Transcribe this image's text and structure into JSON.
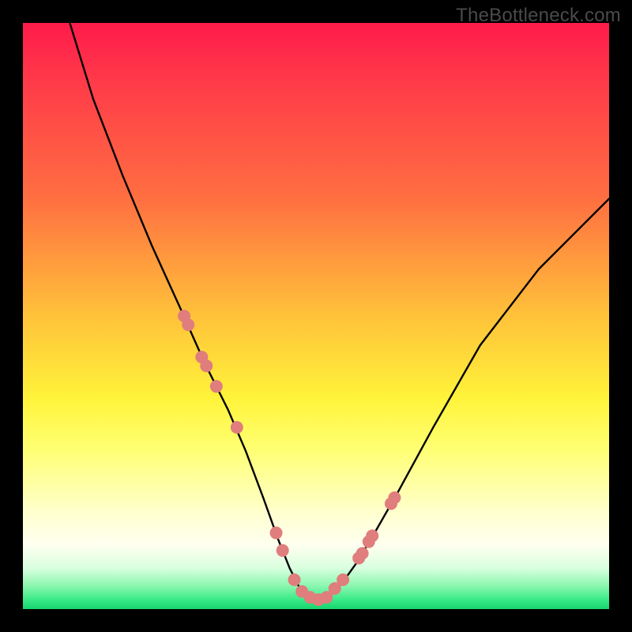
{
  "watermark": "TheBottleneck.com",
  "chart_data": {
    "type": "line",
    "title": "",
    "xlabel": "",
    "ylabel": "",
    "ylim": [
      0,
      100
    ],
    "xlim": [
      0,
      100
    ],
    "series": [
      {
        "name": "bottleneck-curve",
        "x": [
          8,
          12,
          17,
          22,
          27,
          31,
          35,
          38,
          41,
          43.5,
          45.5,
          47,
          48.5,
          50,
          52,
          54.5,
          57,
          60,
          64,
          70,
          78,
          88,
          100
        ],
        "values": [
          100,
          87,
          74,
          62,
          51,
          42,
          34,
          27,
          19,
          12,
          7,
          4,
          2,
          1.5,
          2,
          4.5,
          8,
          13,
          20,
          31,
          45,
          58,
          70
        ]
      }
    ],
    "markers": {
      "name": "highlight-points",
      "x": [
        27.5,
        28.2,
        30.5,
        31.3,
        33,
        36.5,
        43.2,
        44.3,
        46.3,
        47.6,
        49,
        50.4,
        51.8,
        53.2,
        54.6,
        57.3,
        57.9,
        59,
        59.6,
        62.8,
        63.4
      ],
      "values": [
        50,
        48.5,
        43,
        41.5,
        38,
        31,
        13,
        10,
        5,
        3,
        2,
        1.6,
        2,
        3.5,
        5,
        8.7,
        9.5,
        11.5,
        12.5,
        18,
        19
      ]
    },
    "colors": {
      "curve": "#000000",
      "markers": "#e07d7d"
    }
  }
}
